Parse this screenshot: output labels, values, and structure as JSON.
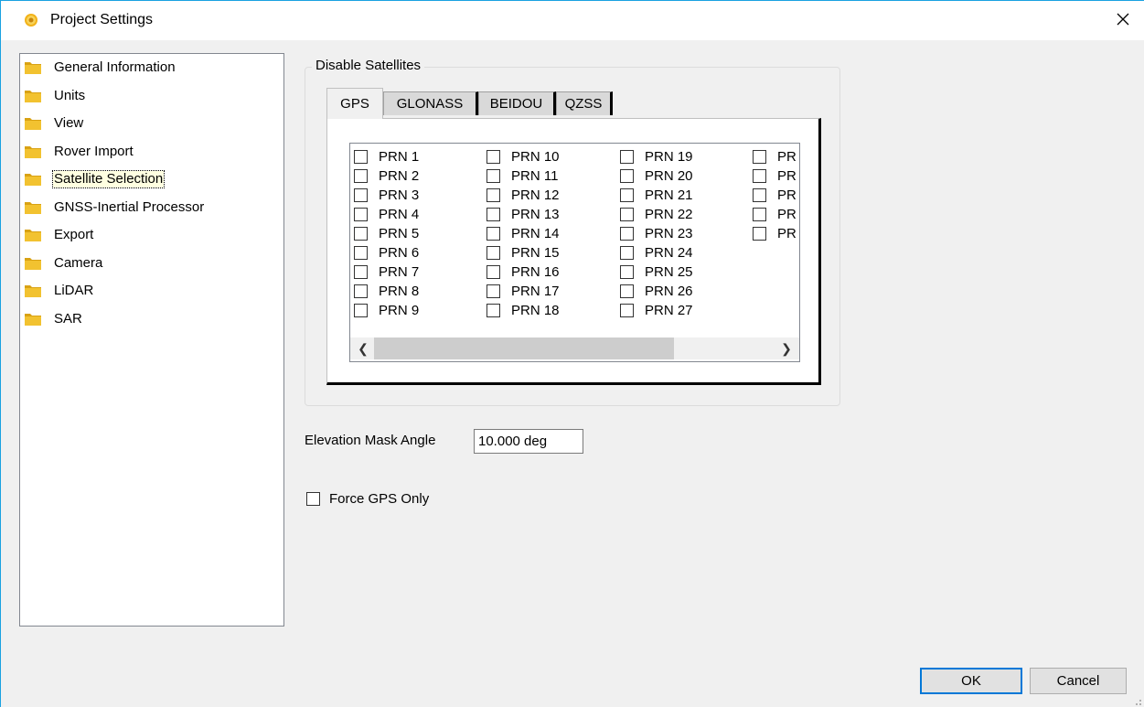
{
  "window": {
    "title": "Project Settings"
  },
  "tree": {
    "items": [
      {
        "label": "General Information",
        "selected": false
      },
      {
        "label": "Units",
        "selected": false
      },
      {
        "label": "View",
        "selected": false
      },
      {
        "label": "Rover Import",
        "selected": false
      },
      {
        "label": "Satellite Selection",
        "selected": true
      },
      {
        "label": "GNSS-Inertial Processor",
        "selected": false
      },
      {
        "label": "Export",
        "selected": false
      },
      {
        "label": "Camera",
        "selected": false
      },
      {
        "label": "LiDAR",
        "selected": false
      },
      {
        "label": "SAR",
        "selected": false
      }
    ]
  },
  "disable_satellites": {
    "group_title": "Disable Satellites",
    "tabs": [
      {
        "label": "GPS",
        "active": true
      },
      {
        "label": "GLONASS",
        "active": false
      },
      {
        "label": "BEIDOU",
        "active": false
      },
      {
        "label": "QZSS",
        "active": false
      }
    ],
    "columns": [
      [
        "PRN 1",
        "PRN 2",
        "PRN 3",
        "PRN 4",
        "PRN 5",
        "PRN 6",
        "PRN 7",
        "PRN 8",
        "PRN 9"
      ],
      [
        "PRN 10",
        "PRN 11",
        "PRN 12",
        "PRN 13",
        "PRN 14",
        "PRN 15",
        "PRN 16",
        "PRN 17",
        "PRN 18"
      ],
      [
        "PRN 19",
        "PRN 20",
        "PRN 21",
        "PRN 22",
        "PRN 23",
        "PRN 24",
        "PRN 25",
        "PRN 26",
        "PRN 27"
      ],
      [
        "PR",
        "PR",
        "PR",
        "PR",
        "PR"
      ]
    ]
  },
  "elevation": {
    "label": "Elevation Mask Angle",
    "value": "10.000 deg"
  },
  "force_gps": {
    "label": "Force GPS Only",
    "checked": false
  },
  "buttons": {
    "ok": "OK",
    "cancel": "Cancel"
  },
  "colors": {
    "accent": "#0078d7",
    "selection_bg": "#ffffe1",
    "folder": "#e8b923"
  }
}
